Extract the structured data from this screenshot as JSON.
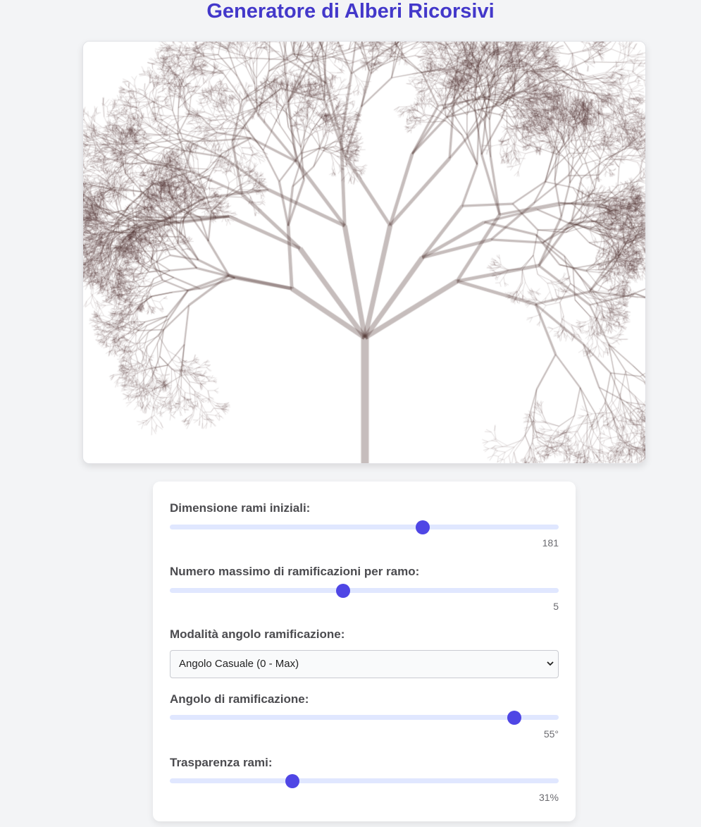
{
  "header": {
    "title": "Generatore di Alberi Ricorsivi"
  },
  "controls": {
    "initial_size": {
      "label": "Dimensione rami iniziali:",
      "value": "181",
      "fraction": 0.65
    },
    "max_branches": {
      "label": "Numero massimo di ramificazioni per ramo:",
      "value": "5",
      "fraction": 0.445
    },
    "angle_mode": {
      "label": "Modalità angolo ramificazione:",
      "selected": "Angolo Casuale (0 - Max)"
    },
    "branch_angle": {
      "label": "Angolo di ramificazione:",
      "value": "55°",
      "fraction": 0.885
    },
    "transparency": {
      "label": "Trasparenza rami:",
      "value": "31%",
      "fraction": 0.315
    }
  },
  "colors": {
    "accent": "#4f46e5",
    "title": "#4338ca",
    "branch": "#4a2c2a",
    "track": "#e0e7ff"
  }
}
